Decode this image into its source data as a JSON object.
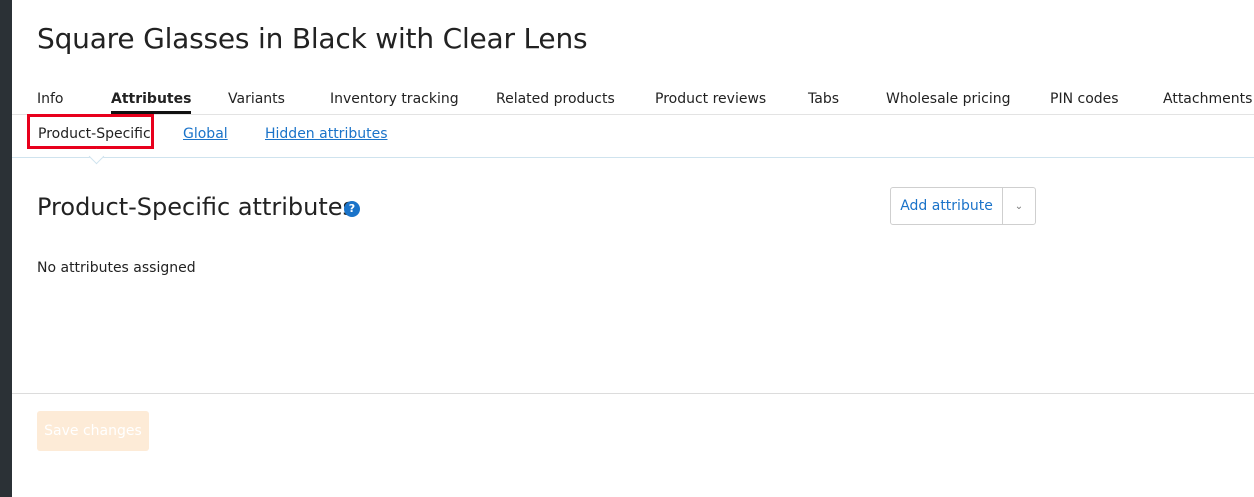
{
  "page": {
    "title": "Square Glasses in Black with Clear Lens"
  },
  "tabs": [
    {
      "label": "Info"
    },
    {
      "label": "Attributes",
      "active": true
    },
    {
      "label": "Variants"
    },
    {
      "label": "Inventory tracking"
    },
    {
      "label": "Related products"
    },
    {
      "label": "Product reviews"
    },
    {
      "label": "Tabs"
    },
    {
      "label": "Wholesale pricing"
    },
    {
      "label": "PIN codes"
    },
    {
      "label": "Attachments",
      "icon": "chevron-down-icon"
    }
  ],
  "subtabs": [
    {
      "label": "Product-Specific",
      "active": true
    },
    {
      "label": "Global"
    },
    {
      "label": "Hidden attributes"
    }
  ],
  "section": {
    "title": "Product-Specific attributes",
    "help_icon": "question-circle-icon",
    "help_glyph": "?",
    "add_button_label": "Add attribute",
    "add_toggle_icon": "chevron-down-icon",
    "empty_text": "No attributes assigned"
  },
  "footer": {
    "save_label": "Save changes",
    "save_enabled": false
  },
  "colors": {
    "link": "#1a73c9",
    "highlight": "#e8001c",
    "save_disabled_bg": "#fdebd7",
    "rail": "#2b3136"
  }
}
